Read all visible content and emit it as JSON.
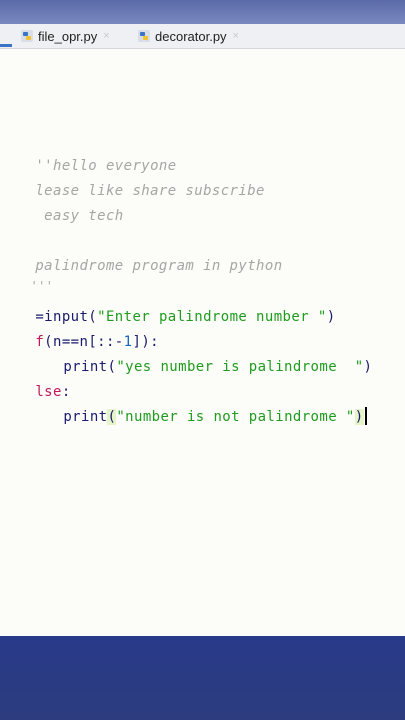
{
  "tabs": [
    {
      "label": "file_opr.py",
      "close": "×"
    },
    {
      "label": "decorator.py",
      "close": "×"
    }
  ],
  "code": {
    "line1": "''hello everyone",
    "line2": "lease like share subscribe",
    "line3": " easy tech",
    "line4": "palindrome program in python",
    "line5": "'''",
    "line6_a": "=input(",
    "line6_str": "\"Enter palindrome number \"",
    "line6_b": ")",
    "line7_kw": "f",
    "line7_a": "(n==n[::-",
    "line7_num": "1",
    "line7_b": "]):",
    "line8_fn": "print(",
    "line8_str": "\"yes number is palindrome  \"",
    "line8_b": ")",
    "line9_kw": "lse",
    "line9_b": ":",
    "line10_fn": "print",
    "line10_open": "(",
    "line10_str": "\"number is not palindrome \"",
    "line10_close": ")"
  }
}
